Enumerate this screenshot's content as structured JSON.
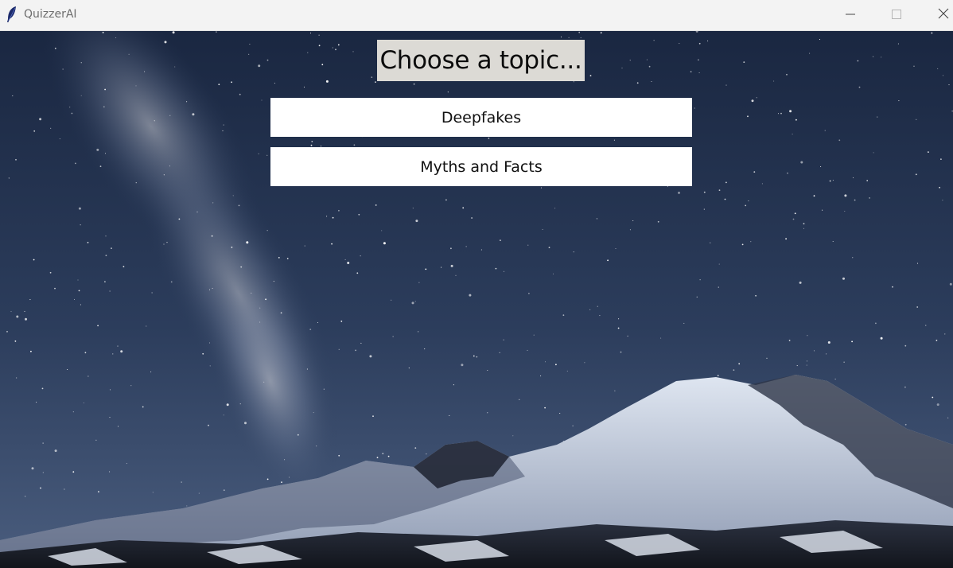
{
  "window": {
    "title": "QuizzerAI",
    "icon": "feather-icon",
    "controls": [
      "minimize-icon",
      "maximize-icon",
      "close-icon"
    ]
  },
  "main": {
    "heading": "Choose a topic...",
    "topics": [
      {
        "label": "Deepfakes"
      },
      {
        "label": "Myths and Facts"
      }
    ],
    "background": "starry-night-mountain-image"
  },
  "colors": {
    "titlebar": "#f3f3f3",
    "heading_bg": "#dcdad5",
    "button_bg": "#ffffff",
    "sky_top": "#1b2a44",
    "sky_bottom": "#3e5375"
  }
}
